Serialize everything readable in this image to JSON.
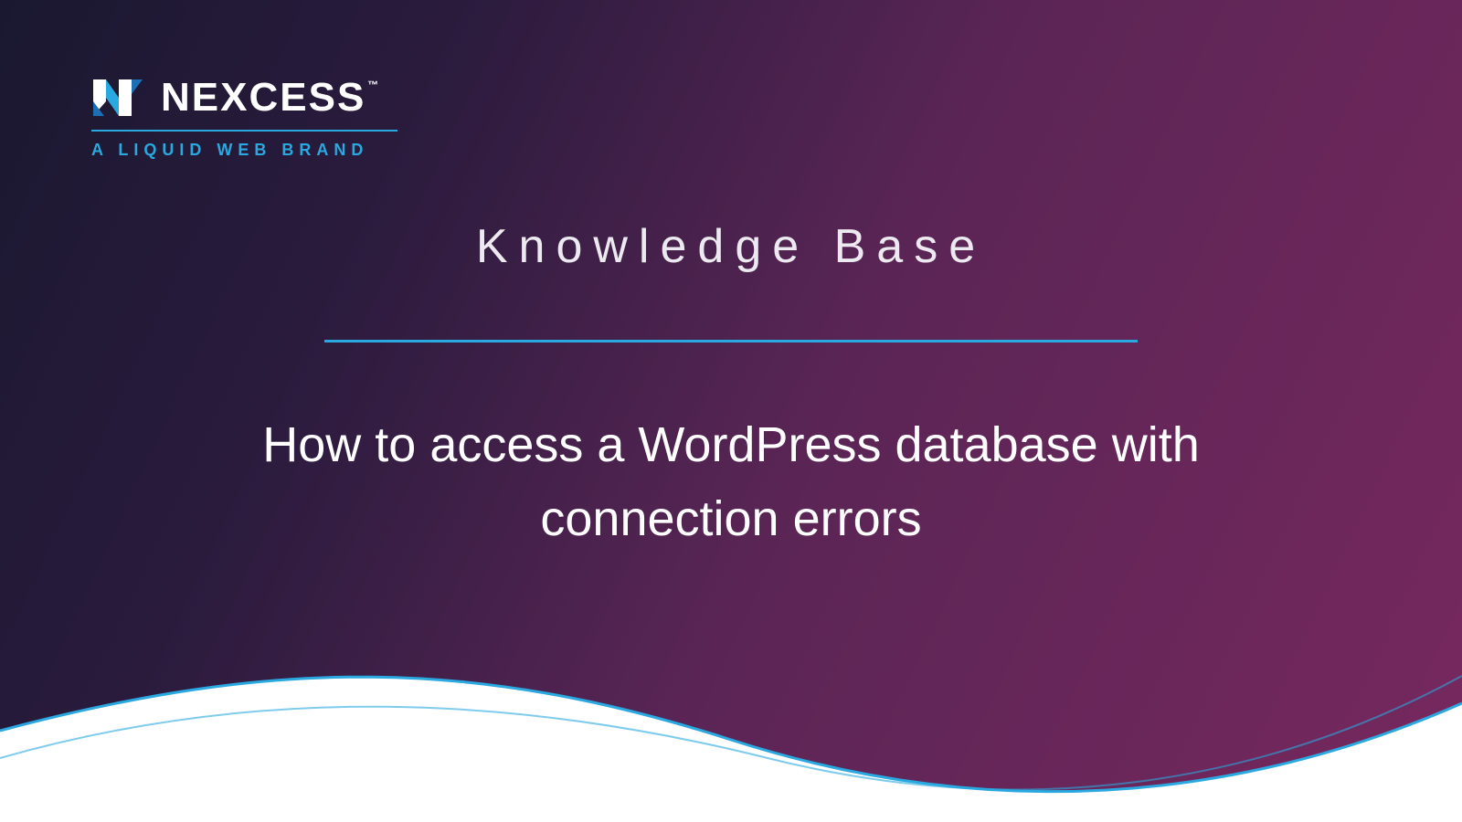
{
  "brand": {
    "wordmark": "NEXCESS",
    "trademark": "™",
    "subline": "A LIQUID WEB BRAND"
  },
  "section_label": "Knowledge Base",
  "article_title": "How to access a WordPress database with connection errors",
  "colors": {
    "accent": "#2aa8e0",
    "accent_alt": "#1c6fb5"
  }
}
